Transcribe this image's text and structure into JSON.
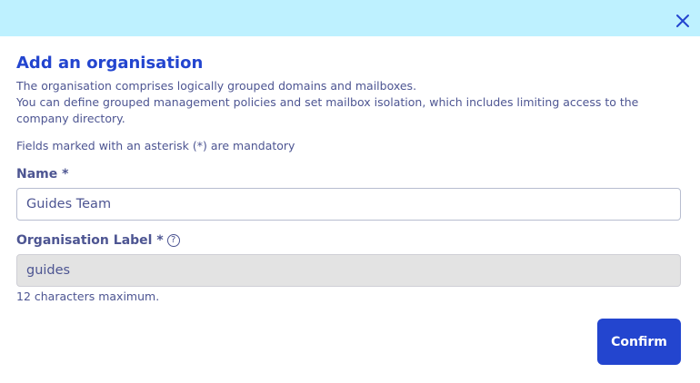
{
  "dialog": {
    "title": "Add an organisation",
    "description_line1": "The organisation comprises logically grouped domains and mailboxes.",
    "description_line2": "You can define grouped management policies and set mailbox isolation, which includes limiting access to the company directory.",
    "mandatory_note": "Fields marked with an asterisk (*) are mandatory",
    "close_icon": "close-icon"
  },
  "form": {
    "name": {
      "label": "Name *",
      "value": "Guides Team"
    },
    "org_label": {
      "label": "Organisation Label *",
      "value": "guides",
      "hint": "12 characters maximum.",
      "help_icon": "?"
    }
  },
  "actions": {
    "confirm_label": "Confirm"
  },
  "colors": {
    "header_bg": "#bef1ff",
    "accent": "#2345cf",
    "text": "#4d5592"
  }
}
